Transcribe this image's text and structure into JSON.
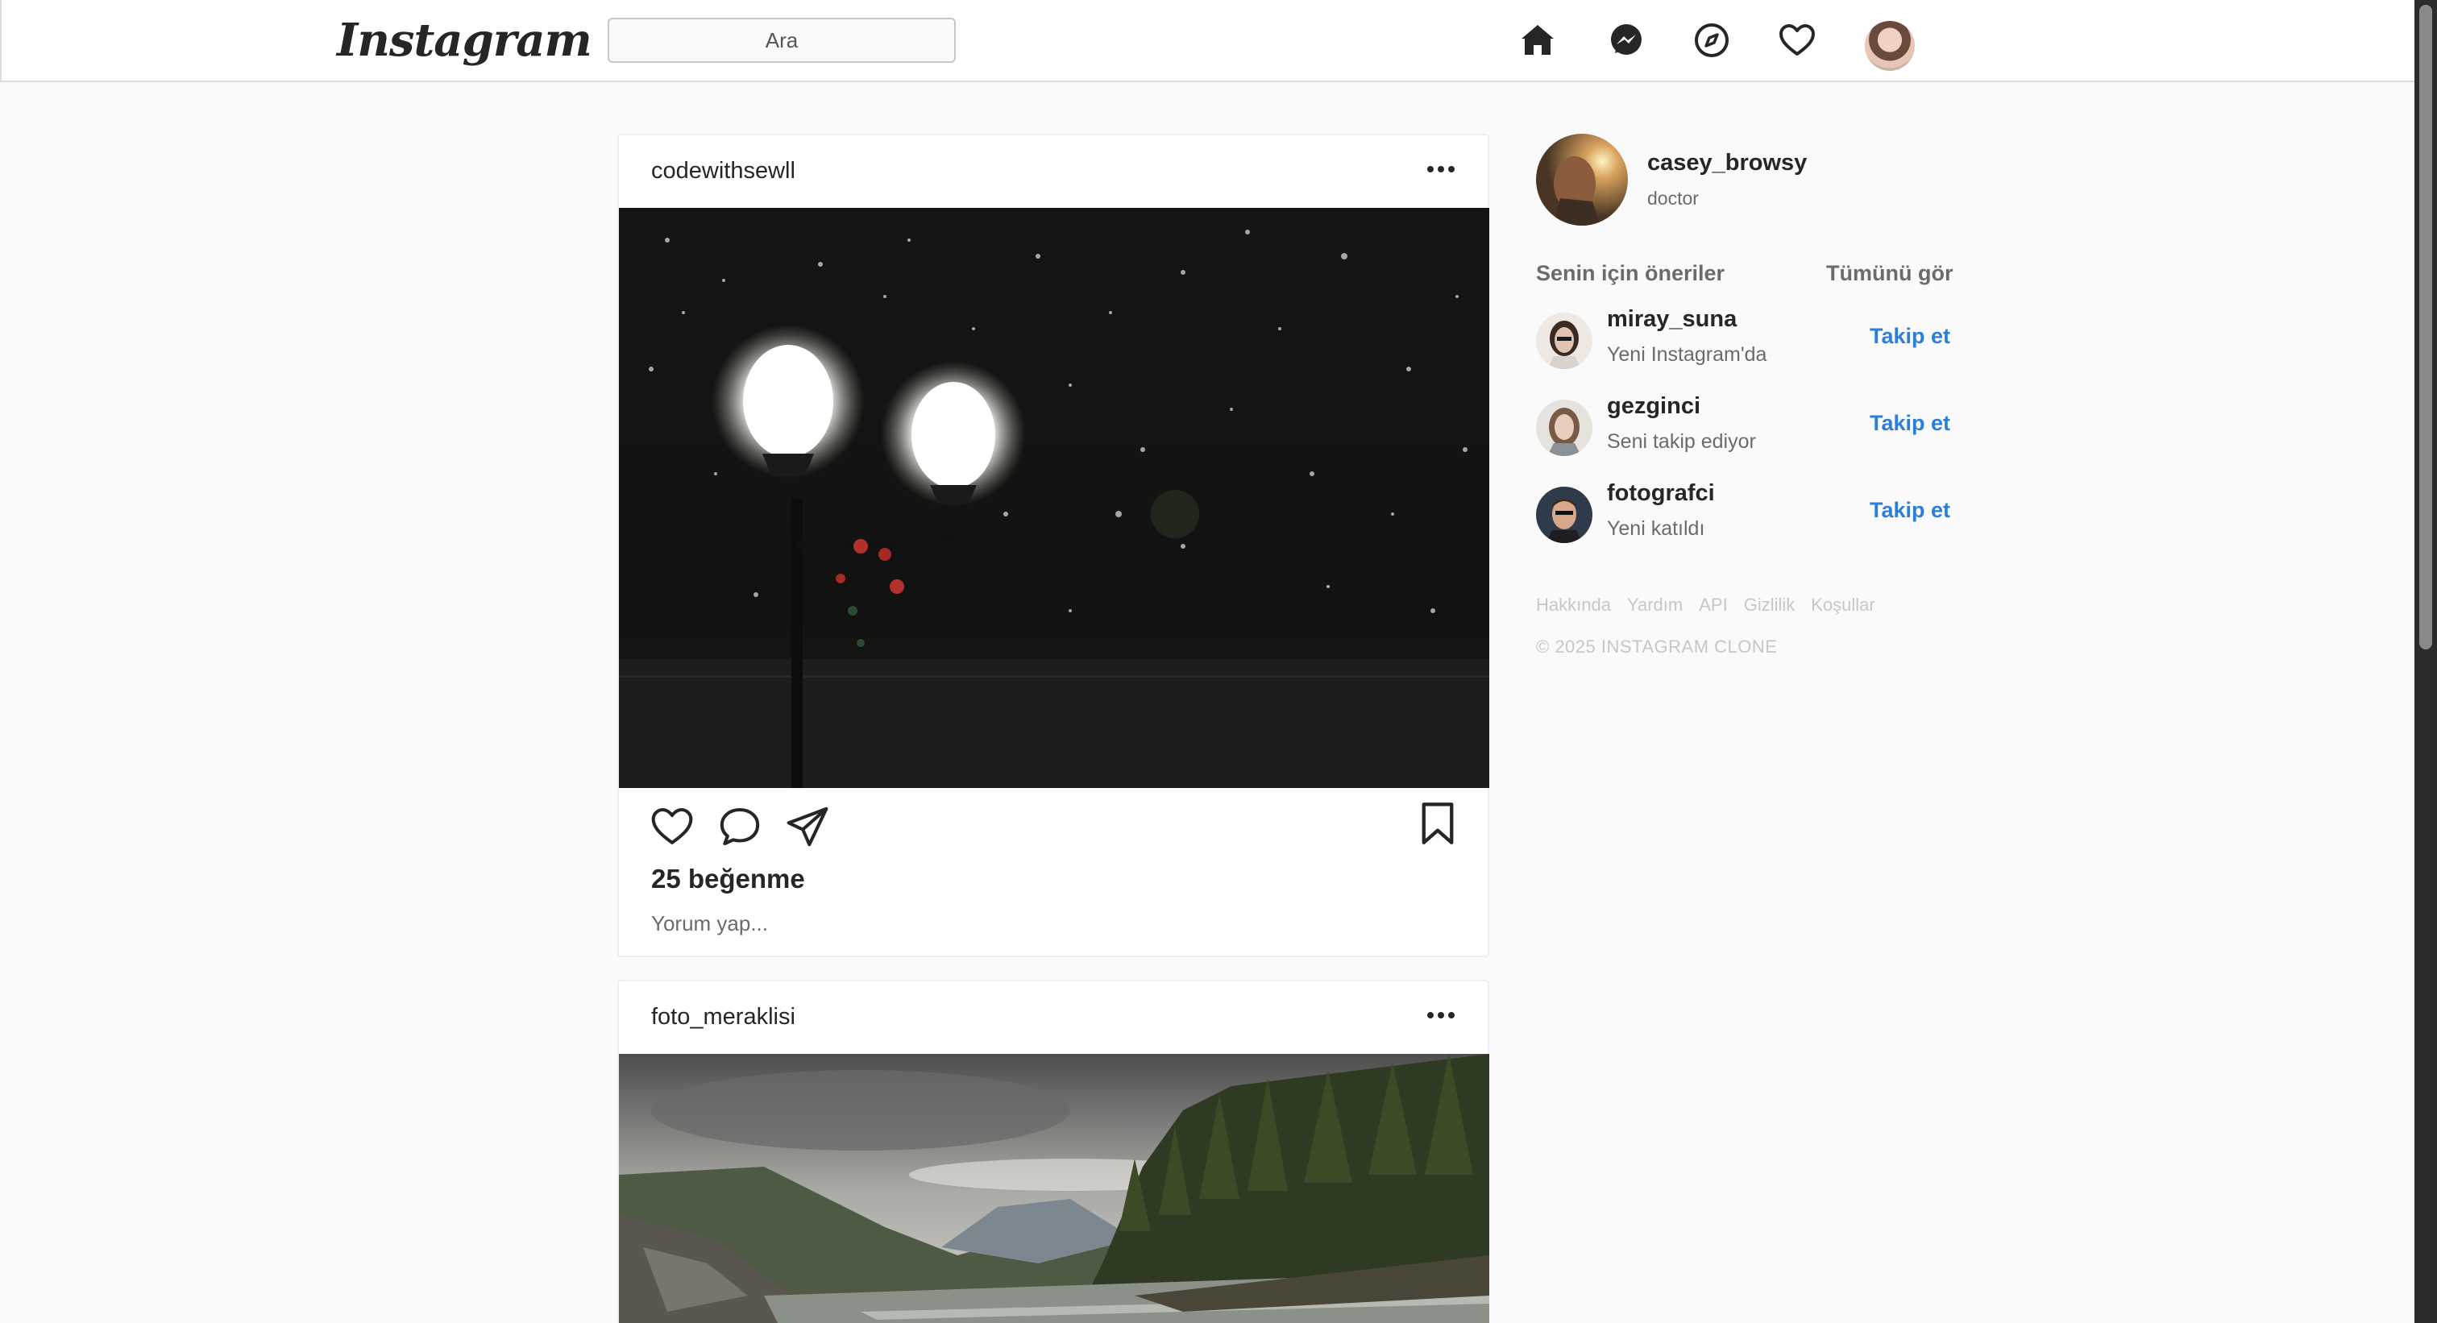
{
  "nav": {
    "logo": "Instagram",
    "search_placeholder": "Ara",
    "icons": [
      "home-icon",
      "messenger-icon",
      "explore-icon",
      "heart-icon",
      "profile-avatar"
    ]
  },
  "posts": [
    {
      "username": "codewithsewll",
      "image": "night-street-lamps-snow",
      "likes": "25 beğenme",
      "comment_placeholder": "Yorum yap..."
    },
    {
      "username": "foto_meraklisi",
      "image": "mountain-river-forest"
    }
  ],
  "sidebar": {
    "me": {
      "username": "casey_browsy",
      "subtitle": "doctor"
    },
    "suggestions_title": "Senin için öneriler",
    "see_all": "Tümünü gör",
    "suggestions": [
      {
        "username": "miray_suna",
        "subtitle": "Yeni Instagram'da",
        "action": "Takip et"
      },
      {
        "username": "gezginci",
        "subtitle": "Seni takip ediyor",
        "action": "Takip et"
      },
      {
        "username": "fotografci",
        "subtitle": "Yeni katıldı",
        "action": "Takip et"
      }
    ],
    "footer_links": [
      "Hakkında",
      "Yardım",
      "API",
      "Gizlilik",
      "Koşullar"
    ],
    "copyright": "© 2025 INSTAGRAM CLONE"
  },
  "colors": {
    "link_blue": "#2c7fd8",
    "muted": "#6b6b6b",
    "border": "#dbdbdb"
  }
}
